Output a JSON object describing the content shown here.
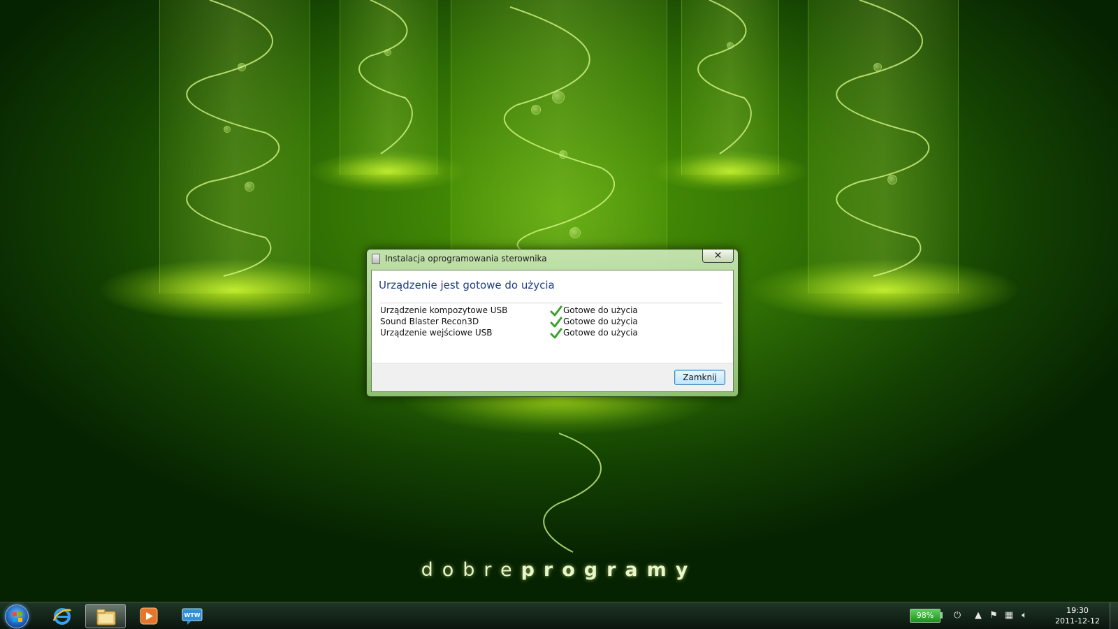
{
  "desktop": {
    "wallpaper_text_light": "dobre",
    "wallpaper_text_bold": "programy"
  },
  "dialog": {
    "title": "Instalacja oprogramowania sterownika",
    "close_glyph": "✕",
    "heading": "Urządzenie jest gotowe do użycia",
    "devices": [
      {
        "name": "Urządzenie kompozytowe USB",
        "status": "Gotowe do użycia"
      },
      {
        "name": "Sound Blaster Recon3D",
        "status": "Gotowe do użycia"
      },
      {
        "name": "Urządzenie wejściowe USB",
        "status": "Gotowe do użycia"
      }
    ],
    "close_button_label": "Zamknij"
  },
  "taskbar": {
    "pinned": [
      {
        "name": "internet-explorer-icon",
        "active": false
      },
      {
        "name": "windows-explorer-icon",
        "active": true
      },
      {
        "name": "media-player-icon",
        "active": false
      },
      {
        "name": "wtw-icon",
        "active": false
      }
    ],
    "wtw_label": "WTW",
    "battery_percent": "98%",
    "time": "19:30",
    "date": "2011-12-12"
  },
  "colors": {
    "heading": "#1e3f8b",
    "check": "#3aa12b",
    "battery": "#2fae2f"
  }
}
